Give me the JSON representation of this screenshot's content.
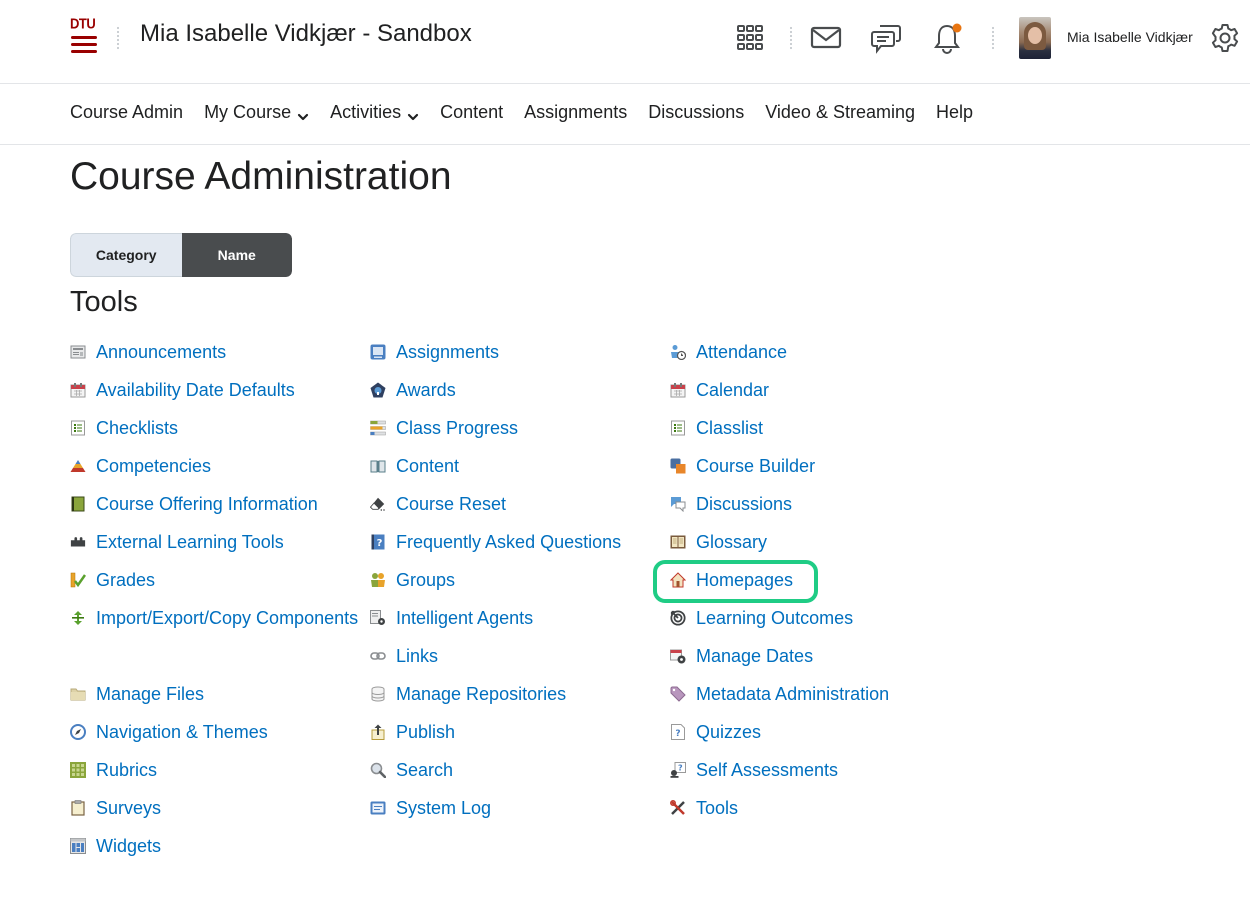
{
  "header": {
    "logo_text": "DTU",
    "site_title": "Mia Isabelle Vidkjær - Sandbox",
    "user_name": "Mia Isabelle Vidkjær",
    "icons": [
      "grid-icon",
      "mail-icon",
      "chat-icon",
      "bell-icon",
      "settings-gear-icon"
    ],
    "notification_dot_color": "#e87511"
  },
  "nav": {
    "items": [
      {
        "label": "Course Admin",
        "dropdown": false
      },
      {
        "label": "My Course",
        "dropdown": true
      },
      {
        "label": "Activities",
        "dropdown": true
      },
      {
        "label": "Content",
        "dropdown": false
      },
      {
        "label": "Assignments",
        "dropdown": false
      },
      {
        "label": "Discussions",
        "dropdown": false
      },
      {
        "label": "Video & Streaming",
        "dropdown": false
      },
      {
        "label": "Help",
        "dropdown": false
      }
    ]
  },
  "page": {
    "title": "Course Administration",
    "view_toggle": {
      "category_label": "Category",
      "name_label": "Name",
      "selected": "Name"
    },
    "section_title": "Tools",
    "link_color": "#006fbf",
    "highlight_color": "#1fcc85",
    "highlighted_tool": "Homepages"
  },
  "tools": {
    "col1": [
      {
        "label": "Announcements",
        "icon": "announcements-icon"
      },
      {
        "label": "Availability Date Defaults",
        "icon": "calendar-icon"
      },
      {
        "label": "Checklists",
        "icon": "checklist-icon"
      },
      {
        "label": "Competencies",
        "icon": "pyramid-icon"
      },
      {
        "label": "Course Offering Information",
        "icon": "book-icon"
      },
      {
        "label": "External Learning Tools",
        "icon": "puzzle-icon"
      },
      {
        "label": "Grades",
        "icon": "grades-icon"
      },
      {
        "label": "Import/Export/Copy Components",
        "icon": "import-export-icon"
      },
      {
        "label": "Manage Files",
        "icon": "folder-icon"
      },
      {
        "label": "Navigation & Themes",
        "icon": "compass-icon"
      },
      {
        "label": "Rubrics",
        "icon": "rubric-grid-icon"
      },
      {
        "label": "Surveys",
        "icon": "clipboard-icon"
      },
      {
        "label": "Widgets",
        "icon": "widgets-icon"
      }
    ],
    "col2": [
      {
        "label": "Assignments",
        "icon": "assignments-icon"
      },
      {
        "label": "Awards",
        "icon": "award-icon"
      },
      {
        "label": "Class Progress",
        "icon": "progress-bars-icon"
      },
      {
        "label": "Content",
        "icon": "open-book-icon"
      },
      {
        "label": "Course Reset",
        "icon": "eraser-icon"
      },
      {
        "label": "Frequently Asked Questions",
        "icon": "faq-icon"
      },
      {
        "label": "Groups",
        "icon": "groups-icon"
      },
      {
        "label": "Intelligent Agents",
        "icon": "agent-gear-icon"
      },
      {
        "label": "Links",
        "icon": "link-icon"
      },
      {
        "label": "Manage Repositories",
        "icon": "database-icon"
      },
      {
        "label": "Publish",
        "icon": "publish-icon"
      },
      {
        "label": "Search",
        "icon": "search-icon"
      },
      {
        "label": "System Log",
        "icon": "system-log-icon"
      }
    ],
    "col3": [
      {
        "label": "Attendance",
        "icon": "attendance-icon"
      },
      {
        "label": "Calendar",
        "icon": "calendar-icon"
      },
      {
        "label": "Classlist",
        "icon": "classlist-icon"
      },
      {
        "label": "Course Builder",
        "icon": "course-builder-icon"
      },
      {
        "label": "Discussions",
        "icon": "discussions-icon"
      },
      {
        "label": "Glossary",
        "icon": "glossary-icon"
      },
      {
        "label": "Homepages",
        "icon": "home-icon"
      },
      {
        "label": "Learning Outcomes",
        "icon": "target-icon"
      },
      {
        "label": "Manage Dates",
        "icon": "manage-dates-icon"
      },
      {
        "label": "Metadata Administration",
        "icon": "tag-icon"
      },
      {
        "label": "Quizzes",
        "icon": "quiz-icon"
      },
      {
        "label": "Self Assessments",
        "icon": "self-assessment-icon"
      },
      {
        "label": "Tools",
        "icon": "tools-icon"
      }
    ]
  }
}
